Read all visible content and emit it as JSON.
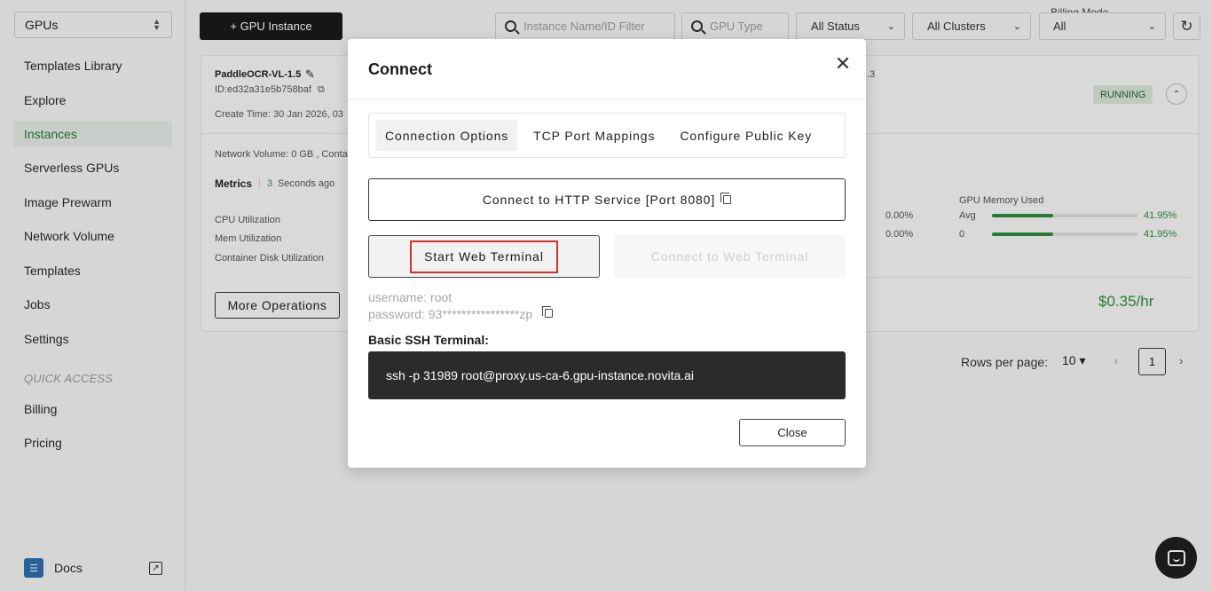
{
  "sidebar": {
    "gpu_select": "GPUs",
    "items": [
      {
        "label": "Templates Library"
      },
      {
        "label": "Explore"
      },
      {
        "label": "Instances"
      },
      {
        "label": "Serverless GPUs"
      },
      {
        "label": "Image Prewarm"
      },
      {
        "label": "Network Volume"
      },
      {
        "label": "Templates"
      },
      {
        "label": "Jobs"
      },
      {
        "label": "Settings"
      }
    ],
    "quick_access_label": "QUICK ACCESS",
    "quick_items": [
      {
        "label": "Billing"
      },
      {
        "label": "Pricing"
      }
    ],
    "docs_label": "Docs"
  },
  "toolbar": {
    "add_instance": "+ GPU Instance",
    "name_filter_placeholder": "Instance Name/ID Filter",
    "gpu_type_placeholder": "GPU Type",
    "status_filter": "All Status",
    "cluster_filter": "All Clusters",
    "billing_mode_label": "Billing Mode",
    "billing_mode_value": "All"
  },
  "instance": {
    "name": "PaddleOCR-VL-1.5",
    "id": "ID:ed32a31e5b758baf",
    "create_time": "Create Time: 30 Jan 2026, 03",
    "truncated_right": ".3",
    "status": "RUNNING",
    "network_volume": "Network Volume: 0 GB , Conta",
    "metrics_label": "Metrics",
    "metrics_count": "3",
    "metrics_age": "Seconds ago",
    "cpu_label": "CPU Utilization",
    "mem_label": "Mem Utilization",
    "disk_label": "Container Disk Utilization",
    "mid_val_1": "0.00%",
    "mid_val_2": "0.00%",
    "gpu_mem_title": "GPU Memory Used",
    "gpu_row1_label": "Avg",
    "gpu_row1_value": "41.95%",
    "gpu_row2_label": "0",
    "gpu_row2_value": "41.95%",
    "gpu_mem_fraction": 0.4195,
    "more_ops": "More Operations",
    "price": "$0.35/hr"
  },
  "pagination": {
    "rows_label": "Rows per page:",
    "rows_value": "10",
    "current_page": "1"
  },
  "modal": {
    "title": "Connect",
    "tabs": [
      {
        "label": "Connection Options",
        "active": true
      },
      {
        "label": "TCP Port Mappings",
        "active": false
      },
      {
        "label": "Configure Public Key",
        "active": false
      }
    ],
    "http_button": "Connect to HTTP Service [Port 8080]",
    "start_terminal": "Start Web Terminal",
    "connect_terminal": "Connect to Web Terminal",
    "username": "username: root",
    "password": "password: 93****************zp",
    "ssh_label": "Basic SSH Terminal:",
    "ssh_command": "ssh -p 31989 root@proxy.us-ca-6.gpu-instance.novita.ai",
    "close_button": "Close"
  },
  "colors": {
    "accent_green": "#2e8b3a",
    "highlight_red": "#d9312b",
    "dark": "#1a1a1a"
  }
}
